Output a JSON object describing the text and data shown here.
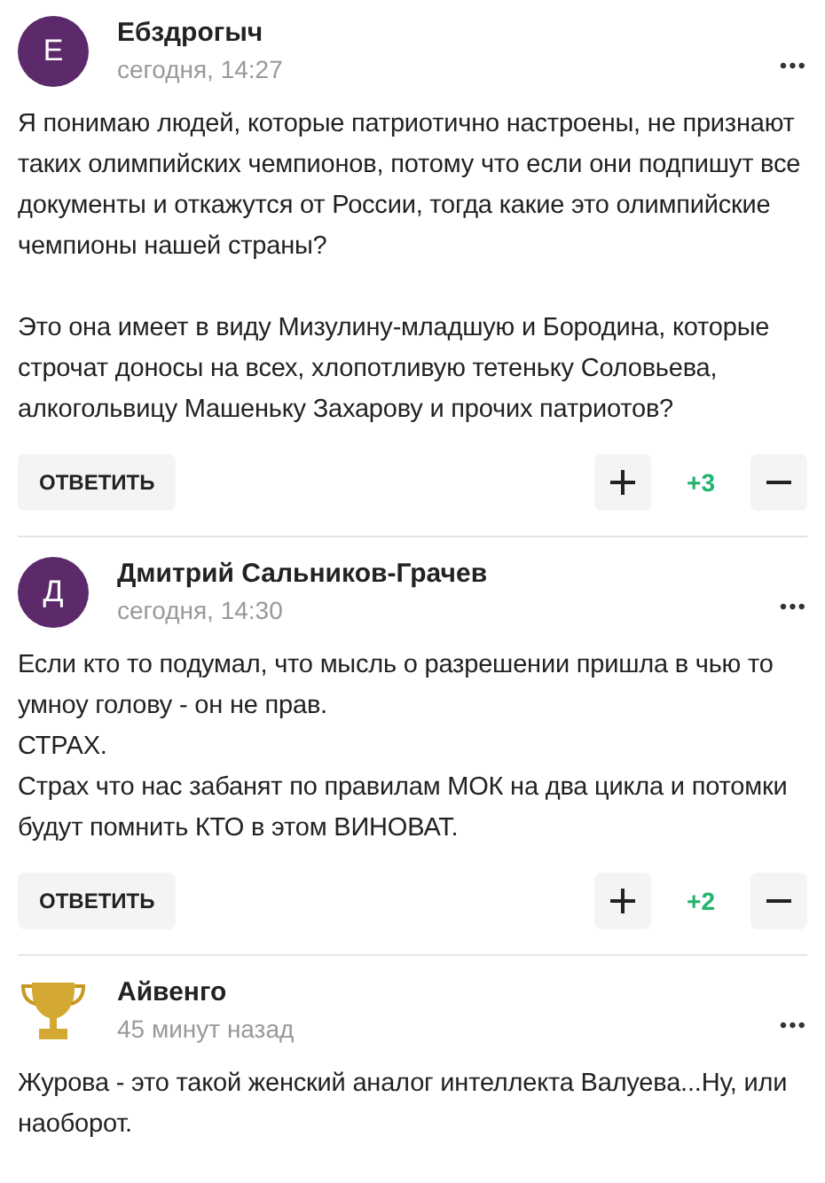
{
  "comments": [
    {
      "avatar": {
        "kind": "letter",
        "letter": "Е"
      },
      "author": "Ебздрогыч",
      "time": "сегодня, 14:27",
      "menu": "•••",
      "paragraphs": [
        [
          "Я понимаю людей, которые патриотично настроены, не признают таких олимпийских чемпионов, потому что если они подпишут все документы и откажутся от России, тогда какие это олимпийские чемпионы нашей страны?"
        ],
        [
          "Это она имеет в виду Мизулину-младшую и Бородина, которые строчат доносы на всех, хлопотливую тетеньку Соловьева, алкогольвицу Машеньку Захарову и прочих патриотов?"
        ]
      ],
      "actions": {
        "reply": "ОТВЕТИТЬ",
        "score": "+3"
      }
    },
    {
      "avatar": {
        "kind": "letter",
        "letter": "Д"
      },
      "author": "Дмитрий Сальников-Грачев",
      "time": "сегодня, 14:30",
      "menu": "•••",
      "paragraphs": [
        [
          "Если кто то подумал, что мысль о разрешении пришла в чью то умноу голову - он не прав.",
          "СТРАХ.",
          "Страх что нас забанят по правилам МОК на два цикла и потомки будут помнить КТО в этом ВИНОВАТ."
        ]
      ],
      "actions": {
        "reply": "ОТВЕТИТЬ",
        "score": "+2"
      }
    },
    {
      "avatar": {
        "kind": "trophy"
      },
      "author": "Айвенго",
      "time": "45 минут назад",
      "menu": "•••",
      "paragraphs": [
        [
          "Журова - это такой женский аналог интеллекта Валуева...Ну, или наоборот."
        ]
      ]
    }
  ]
}
